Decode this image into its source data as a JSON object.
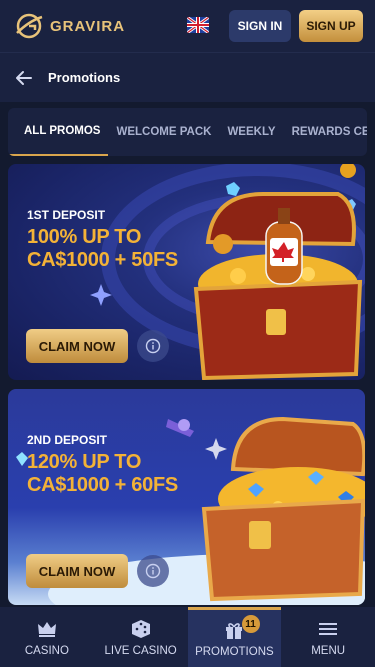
{
  "header": {
    "brand": "GRAVIRA",
    "sign_in": "SIGN IN",
    "sign_up": "SIGN UP",
    "language_icon": "uk-flag-icon"
  },
  "subheader": {
    "title": "Promotions"
  },
  "tabs": [
    {
      "label": "ALL PROMOS",
      "active": true
    },
    {
      "label": "WELCOME PACK",
      "active": false
    },
    {
      "label": "WEEKLY",
      "active": false
    },
    {
      "label": "REWARDS CEN",
      "active": false
    }
  ],
  "promos": [
    {
      "label": "1ST DEPOSIT",
      "headline_line1": "100% UP TO",
      "headline_line2": "CA$1000 + 50FS",
      "cta": "CLAIM NOW"
    },
    {
      "label": "2ND DEPOSIT",
      "headline_line1": "120% UP TO",
      "headline_line2": "CA$1000 + 60FS",
      "cta": "CLAIM NOW"
    }
  ],
  "bottom_nav": [
    {
      "label": "CASINO",
      "icon": "crown-icon"
    },
    {
      "label": "LIVE CASINO",
      "icon": "dice-icon"
    },
    {
      "label": "PROMOTIONS",
      "icon": "gift-icon",
      "badge": "11",
      "active": true
    },
    {
      "label": "MENU",
      "icon": "menu-icon"
    }
  ],
  "colors": {
    "accent_gold": "#d9a54d",
    "headline_orange": "#f3b237",
    "bg_dark": "#131a2f",
    "panel": "#1a2240"
  }
}
